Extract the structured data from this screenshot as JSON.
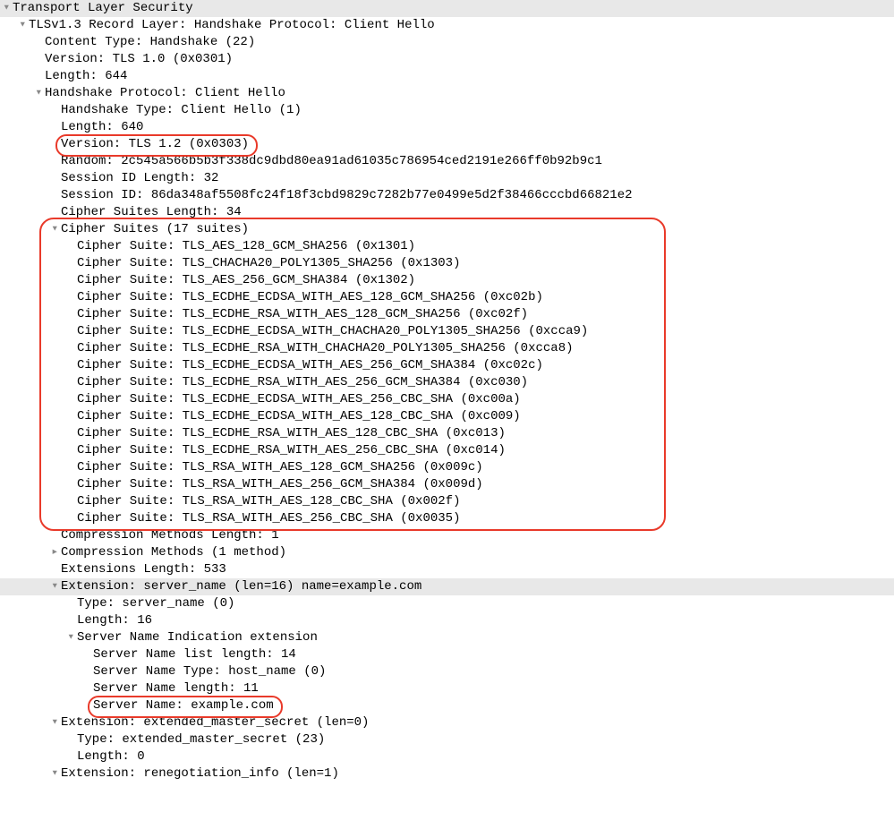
{
  "tls_header": "Transport Layer Security",
  "record_layer": "TLSv1.3 Record Layer: Handshake Protocol: Client Hello",
  "content_type": "Content Type: Handshake (22)",
  "record_version": "Version: TLS 1.0 (0x0301)",
  "record_length": "Length: 644",
  "handshake_header": "Handshake Protocol: Client Hello",
  "handshake_type": "Handshake Type: Client Hello (1)",
  "handshake_length": "Length: 640",
  "handshake_version": "Version: TLS 1.2 (0x0303)",
  "random": "Random: 2c545a566b5b3f338dc9dbd80ea91ad61035c786954ced2191e266ff0b92b9c1",
  "session_id_length": "Session ID Length: 32",
  "session_id": "Session ID: 86da348af5508fc24f18f3cbd9829c7282b77e0499e5d2f38466cccbd66821e2",
  "cipher_suites_length": "Cipher Suites Length: 34",
  "cipher_suites_header": "Cipher Suites (17 suites)",
  "cipher_suites": [
    "Cipher Suite: TLS_AES_128_GCM_SHA256 (0x1301)",
    "Cipher Suite: TLS_CHACHA20_POLY1305_SHA256 (0x1303)",
    "Cipher Suite: TLS_AES_256_GCM_SHA384 (0x1302)",
    "Cipher Suite: TLS_ECDHE_ECDSA_WITH_AES_128_GCM_SHA256 (0xc02b)",
    "Cipher Suite: TLS_ECDHE_RSA_WITH_AES_128_GCM_SHA256 (0xc02f)",
    "Cipher Suite: TLS_ECDHE_ECDSA_WITH_CHACHA20_POLY1305_SHA256 (0xcca9)",
    "Cipher Suite: TLS_ECDHE_RSA_WITH_CHACHA20_POLY1305_SHA256 (0xcca8)",
    "Cipher Suite: TLS_ECDHE_ECDSA_WITH_AES_256_GCM_SHA384 (0xc02c)",
    "Cipher Suite: TLS_ECDHE_RSA_WITH_AES_256_GCM_SHA384 (0xc030)",
    "Cipher Suite: TLS_ECDHE_ECDSA_WITH_AES_256_CBC_SHA (0xc00a)",
    "Cipher Suite: TLS_ECDHE_ECDSA_WITH_AES_128_CBC_SHA (0xc009)",
    "Cipher Suite: TLS_ECDHE_RSA_WITH_AES_128_CBC_SHA (0xc013)",
    "Cipher Suite: TLS_ECDHE_RSA_WITH_AES_256_CBC_SHA (0xc014)",
    "Cipher Suite: TLS_RSA_WITH_AES_128_GCM_SHA256 (0x009c)",
    "Cipher Suite: TLS_RSA_WITH_AES_256_GCM_SHA384 (0x009d)",
    "Cipher Suite: TLS_RSA_WITH_AES_128_CBC_SHA (0x002f)",
    "Cipher Suite: TLS_RSA_WITH_AES_256_CBC_SHA (0x0035)"
  ],
  "compression_methods_length": "Compression Methods Length: 1",
  "compression_methods": "Compression Methods (1 method)",
  "extensions_length": "Extensions Length: 533",
  "ext_server_name_header": "Extension: server_name (len=16) name=example.com",
  "ext_server_name_type": "Type: server_name (0)",
  "ext_server_name_length": "Length: 16",
  "sni_header": "Server Name Indication extension",
  "sni_list_length": "Server Name list length: 14",
  "sni_name_type": "Server Name Type: host_name (0)",
  "sni_name_length": "Server Name length: 11",
  "sni_name": "Server Name: example.com",
  "ext_ems_header": "Extension: extended_master_secret (len=0)",
  "ext_ems_type": "Type: extended_master_secret (23)",
  "ext_ems_length": "Length: 0",
  "ext_reneg_header": "Extension: renegotiation_info (len=1)"
}
